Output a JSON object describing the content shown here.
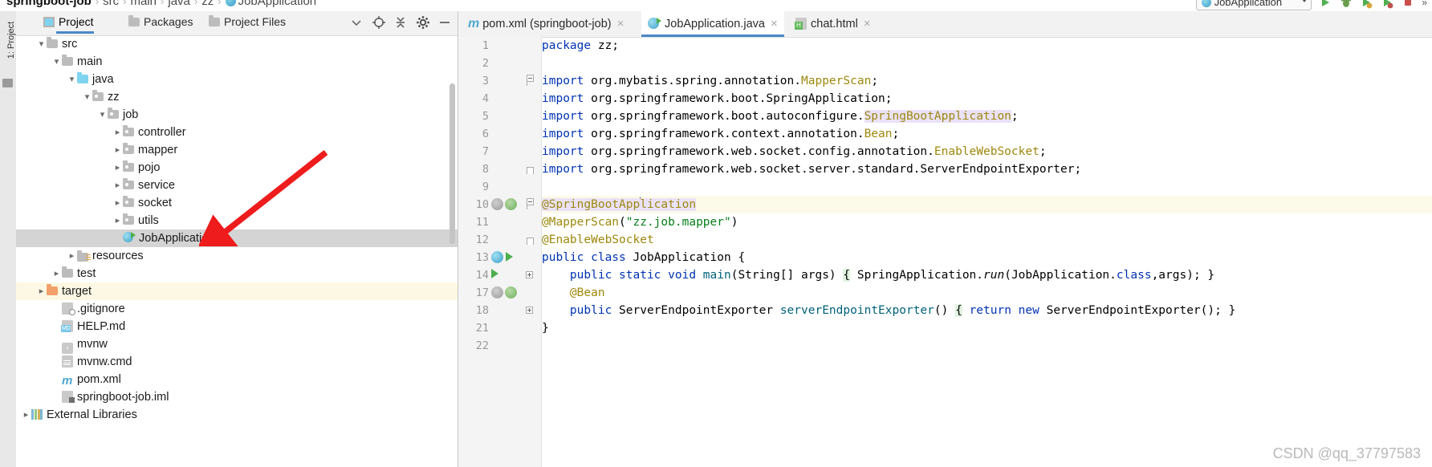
{
  "breadcrumb": {
    "project": "springboot-job",
    "items": [
      "src",
      "main",
      "java",
      "zz"
    ],
    "file": "JobApplication",
    "file_icon": "java-class-icon",
    "separator": "›"
  },
  "top_right": {
    "run_config": "JobApplication",
    "run_config_icon": "java-class-icon",
    "dropdown_icon": "chevron-down-icon",
    "icons": [
      "run-icon",
      "debug-icon",
      "coverage-icon",
      "profile-icon",
      "stop-icon",
      "chevron-double-icon"
    ]
  },
  "left_rail": {
    "label": "1: Project",
    "tool_icon": "project-tool-icon"
  },
  "project_panel": {
    "tabs": [
      {
        "label": "Project",
        "icon": "project-icon",
        "active": true
      },
      {
        "label": "Packages",
        "icon": "folder-icon",
        "active": false
      },
      {
        "label": "Project Files",
        "icon": "folder-icon",
        "active": false
      }
    ],
    "header_buttons": [
      {
        "name": "chevron-down-icon",
        "glyph": "ˇ"
      },
      {
        "name": "locate-icon",
        "glyph": "⊕"
      },
      {
        "name": "collapse-all-icon",
        "glyph": "⤓"
      },
      {
        "name": "settings-gear-icon",
        "glyph": "⚙"
      },
      {
        "name": "hide-icon",
        "glyph": "—"
      }
    ],
    "tree": [
      {
        "label": "src",
        "indent": 1,
        "twisty": "v",
        "icon": "folder-icon",
        "state": "normal"
      },
      {
        "label": "main",
        "indent": 2,
        "twisty": "v",
        "icon": "folder-icon",
        "state": "normal"
      },
      {
        "label": "java",
        "indent": 3,
        "twisty": "v",
        "icon": "folder-blue-icon",
        "state": "normal"
      },
      {
        "label": "zz",
        "indent": 4,
        "twisty": "v",
        "icon": "package-icon",
        "state": "normal"
      },
      {
        "label": "job",
        "indent": 5,
        "twisty": "v",
        "icon": "package-icon",
        "state": "normal"
      },
      {
        "label": "controller",
        "indent": 6,
        "twisty": ">",
        "icon": "package-icon",
        "state": "normal"
      },
      {
        "label": "mapper",
        "indent": 6,
        "twisty": ">",
        "icon": "package-icon",
        "state": "normal"
      },
      {
        "label": "pojo",
        "indent": 6,
        "twisty": ">",
        "icon": "package-icon",
        "state": "normal"
      },
      {
        "label": "service",
        "indent": 6,
        "twisty": ">",
        "icon": "package-icon",
        "state": "normal"
      },
      {
        "label": "socket",
        "indent": 6,
        "twisty": ">",
        "icon": "package-icon",
        "state": "normal"
      },
      {
        "label": "utils",
        "indent": 6,
        "twisty": ">",
        "icon": "package-icon",
        "state": "normal"
      },
      {
        "label": "JobApplication",
        "indent": 6,
        "twisty": "none",
        "icon": "java-class-run-icon",
        "state": "selected"
      },
      {
        "label": "resources",
        "indent": 3,
        "twisty": ">",
        "icon": "resources-folder-icon",
        "state": "normal"
      },
      {
        "label": "test",
        "indent": 2,
        "twisty": ">",
        "icon": "folder-icon",
        "state": "normal"
      },
      {
        "label": "target",
        "indent": 1,
        "twisty": ">",
        "icon": "folder-orange-icon",
        "state": "highlight"
      },
      {
        "label": ".gitignore",
        "indent": 2,
        "twisty": "none",
        "icon": "gitignore-icon",
        "state": "normal"
      },
      {
        "label": "HELP.md",
        "indent": 2,
        "twisty": "none",
        "icon": "markdown-icon",
        "state": "normal"
      },
      {
        "label": "mvnw",
        "indent": 2,
        "twisty": "none",
        "icon": "shell-script-icon",
        "state": "normal"
      },
      {
        "label": "mvnw.cmd",
        "indent": 2,
        "twisty": "none",
        "icon": "text-file-icon",
        "state": "normal"
      },
      {
        "label": "pom.xml",
        "indent": 2,
        "twisty": "none",
        "icon": "maven-icon",
        "state": "normal"
      },
      {
        "label": "springboot-job.iml",
        "indent": 2,
        "twisty": "none",
        "icon": "iml-module-icon",
        "state": "normal"
      },
      {
        "label": "External Libraries",
        "indent": 0,
        "twisty": ">",
        "icon": "libraries-icon",
        "state": "normal"
      }
    ]
  },
  "editor": {
    "tabs": [
      {
        "label": "pom.xml (springboot-job)",
        "icon": "maven-icon",
        "active": false,
        "close": "×"
      },
      {
        "label": "JobApplication.java",
        "icon": "java-class-run-icon",
        "active": true,
        "close": "×"
      },
      {
        "label": "chat.html",
        "icon": "html-file-icon",
        "active": false,
        "close": "×"
      }
    ],
    "lines": [
      {
        "no": "1",
        "caret": false,
        "fold": "none",
        "tokens": [
          {
            "t": "package ",
            "c": "kw"
          },
          {
            "t": "zz;",
            "c": "ident"
          }
        ]
      },
      {
        "no": "2",
        "caret": false,
        "fold": "none",
        "tokens": []
      },
      {
        "no": "3",
        "caret": false,
        "fold": "foldtop",
        "tokens": [
          {
            "t": "import ",
            "c": "kw"
          },
          {
            "t": "org.mybatis.spring.annotation.",
            "c": "ident"
          },
          {
            "t": "MapperScan",
            "c": "anno"
          },
          {
            "t": ";",
            "c": "ident"
          }
        ]
      },
      {
        "no": "4",
        "caret": false,
        "fold": "none",
        "tokens": [
          {
            "t": "import ",
            "c": "kw"
          },
          {
            "t": "org.springframework.boot.SpringApplication;",
            "c": "ident"
          }
        ]
      },
      {
        "no": "5",
        "caret": false,
        "fold": "none",
        "tokens": [
          {
            "t": "import ",
            "c": "kw"
          },
          {
            "t": "org.springframework.boot.autoconfigure.",
            "c": "ident"
          },
          {
            "t": "SpringBootApplication",
            "c": "anno hl-purple"
          },
          {
            "t": ";",
            "c": "ident"
          }
        ]
      },
      {
        "no": "6",
        "caret": false,
        "fold": "none",
        "tokens": [
          {
            "t": "import ",
            "c": "kw"
          },
          {
            "t": "org.springframework.context.annotation.",
            "c": "ident"
          },
          {
            "t": "Bean",
            "c": "anno"
          },
          {
            "t": ";",
            "c": "ident"
          }
        ]
      },
      {
        "no": "7",
        "caret": false,
        "fold": "none",
        "tokens": [
          {
            "t": "import ",
            "c": "kw"
          },
          {
            "t": "org.springframework.web.socket.config.annotation.",
            "c": "ident"
          },
          {
            "t": "EnableWebSocket",
            "c": "anno"
          },
          {
            "t": ";",
            "c": "ident"
          }
        ]
      },
      {
        "no": "8",
        "caret": false,
        "fold": "foldend",
        "tokens": [
          {
            "t": "import ",
            "c": "kw"
          },
          {
            "t": "org.springframework.web.socket.server.standard.ServerEndpointExporter;",
            "c": "ident"
          }
        ]
      },
      {
        "no": "9",
        "caret": false,
        "fold": "none",
        "tokens": []
      },
      {
        "no": "10",
        "caret": true,
        "fold": "foldtop",
        "gutter": [
          "bean-gray",
          "bean-green"
        ],
        "tokens": [
          {
            "t": "@SpringBootApp",
            "c": "anno hl-purple"
          },
          {
            "t": "CARET",
            "c": "caret"
          },
          {
            "t": "lication",
            "c": "anno hl-purple"
          }
        ]
      },
      {
        "no": "11",
        "caret": false,
        "fold": "none",
        "tokens": [
          {
            "t": "@MapperScan",
            "c": "anno"
          },
          {
            "t": "(",
            "c": "ident"
          },
          {
            "t": "\"zz.job.mapper\"",
            "c": "str"
          },
          {
            "t": ")",
            "c": "ident"
          }
        ]
      },
      {
        "no": "12",
        "caret": false,
        "fold": "foldend",
        "tokens": [
          {
            "t": "@EnableWebSocket",
            "c": "anno"
          }
        ]
      },
      {
        "no": "13",
        "caret": false,
        "fold": "none",
        "gutter": [
          "class-ico",
          "run-play"
        ],
        "tokens": [
          {
            "t": "public ",
            "c": "kw"
          },
          {
            "t": "class ",
            "c": "kw"
          },
          {
            "t": "JobApplication",
            "c": "ident"
          },
          {
            "t": " {",
            "c": "ident"
          }
        ]
      },
      {
        "no": "14",
        "caret": false,
        "fold": "plus",
        "gutter": [
          "run-play"
        ],
        "tokens": [
          {
            "t": "    ",
            "c": "ident"
          },
          {
            "t": "public ",
            "c": "kw"
          },
          {
            "t": "static ",
            "c": "kw"
          },
          {
            "t": "void ",
            "c": "kw"
          },
          {
            "t": "main",
            "c": "fn"
          },
          {
            "t": "(String[] args) ",
            "c": "ident"
          },
          {
            "t": "{",
            "c": "ident hl-green"
          },
          {
            "t": " SpringApplication.",
            "c": "ident"
          },
          {
            "t": "run",
            "c": "meth-italic"
          },
          {
            "t": "(JobApplication.",
            "c": "ident"
          },
          {
            "t": "class",
            "c": "kw"
          },
          {
            "t": ",args); }",
            "c": "ident"
          }
        ]
      },
      {
        "no": "17",
        "caret": false,
        "fold": "none",
        "gutter": [
          "bean-gray",
          "bean-green"
        ],
        "tokens": [
          {
            "t": "    ",
            "c": "ident"
          },
          {
            "t": "@Bean",
            "c": "anno"
          }
        ]
      },
      {
        "no": "18",
        "caret": false,
        "fold": "plus",
        "tokens": [
          {
            "t": "    ",
            "c": "ident"
          },
          {
            "t": "public ",
            "c": "kw"
          },
          {
            "t": "ServerEndpointExporter ",
            "c": "ident"
          },
          {
            "t": "serverEndpointExporter",
            "c": "fn"
          },
          {
            "t": "() ",
            "c": "ident"
          },
          {
            "t": "{",
            "c": "ident hl-green"
          },
          {
            "t": " ",
            "c": "ident"
          },
          {
            "t": "return ",
            "c": "kw"
          },
          {
            "t": "new ",
            "c": "kw"
          },
          {
            "t": "ServerEndpointExporter(); }",
            "c": "ident"
          }
        ]
      },
      {
        "no": "21",
        "caret": false,
        "fold": "none",
        "tokens": [
          {
            "t": "}",
            "c": "ident"
          }
        ]
      },
      {
        "no": "22",
        "caret": false,
        "fold": "none",
        "tokens": []
      }
    ]
  },
  "annotation": {
    "arrow": "red-arrow-pointing-to-JobApplication",
    "arrow_color": "#ee1c1c"
  },
  "watermark": {
    "text": "CSDN @qq_37797583",
    "color": "#b9b9b9"
  }
}
